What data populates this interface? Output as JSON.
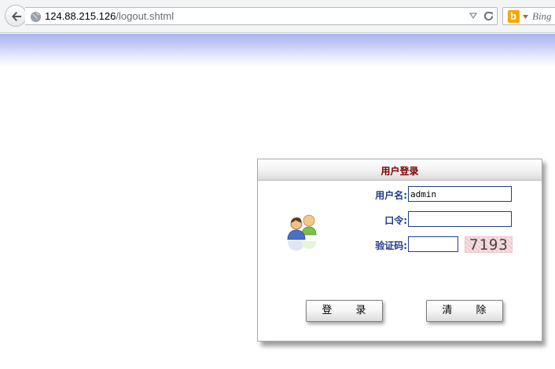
{
  "browser": {
    "url_host": "124.88.215.126",
    "url_path": "/logout.shtml",
    "search_placeholder": "Bing",
    "search_engine_icon": "bing-icon"
  },
  "login_panel": {
    "title": "用户登录",
    "username_label": "用户名:",
    "username_value": "admin",
    "password_label": "口令:",
    "password_value": "",
    "captcha_label": "验证码:",
    "captcha_value": "",
    "captcha_text": "7193",
    "login_button": "登 录",
    "clear_button": "清 除",
    "icon": "users-icon"
  },
  "colors": {
    "label": "#1f3a8c",
    "title": "#7a0000",
    "input_border": "#1f3f8f",
    "banner_top": "#aab4ee"
  }
}
